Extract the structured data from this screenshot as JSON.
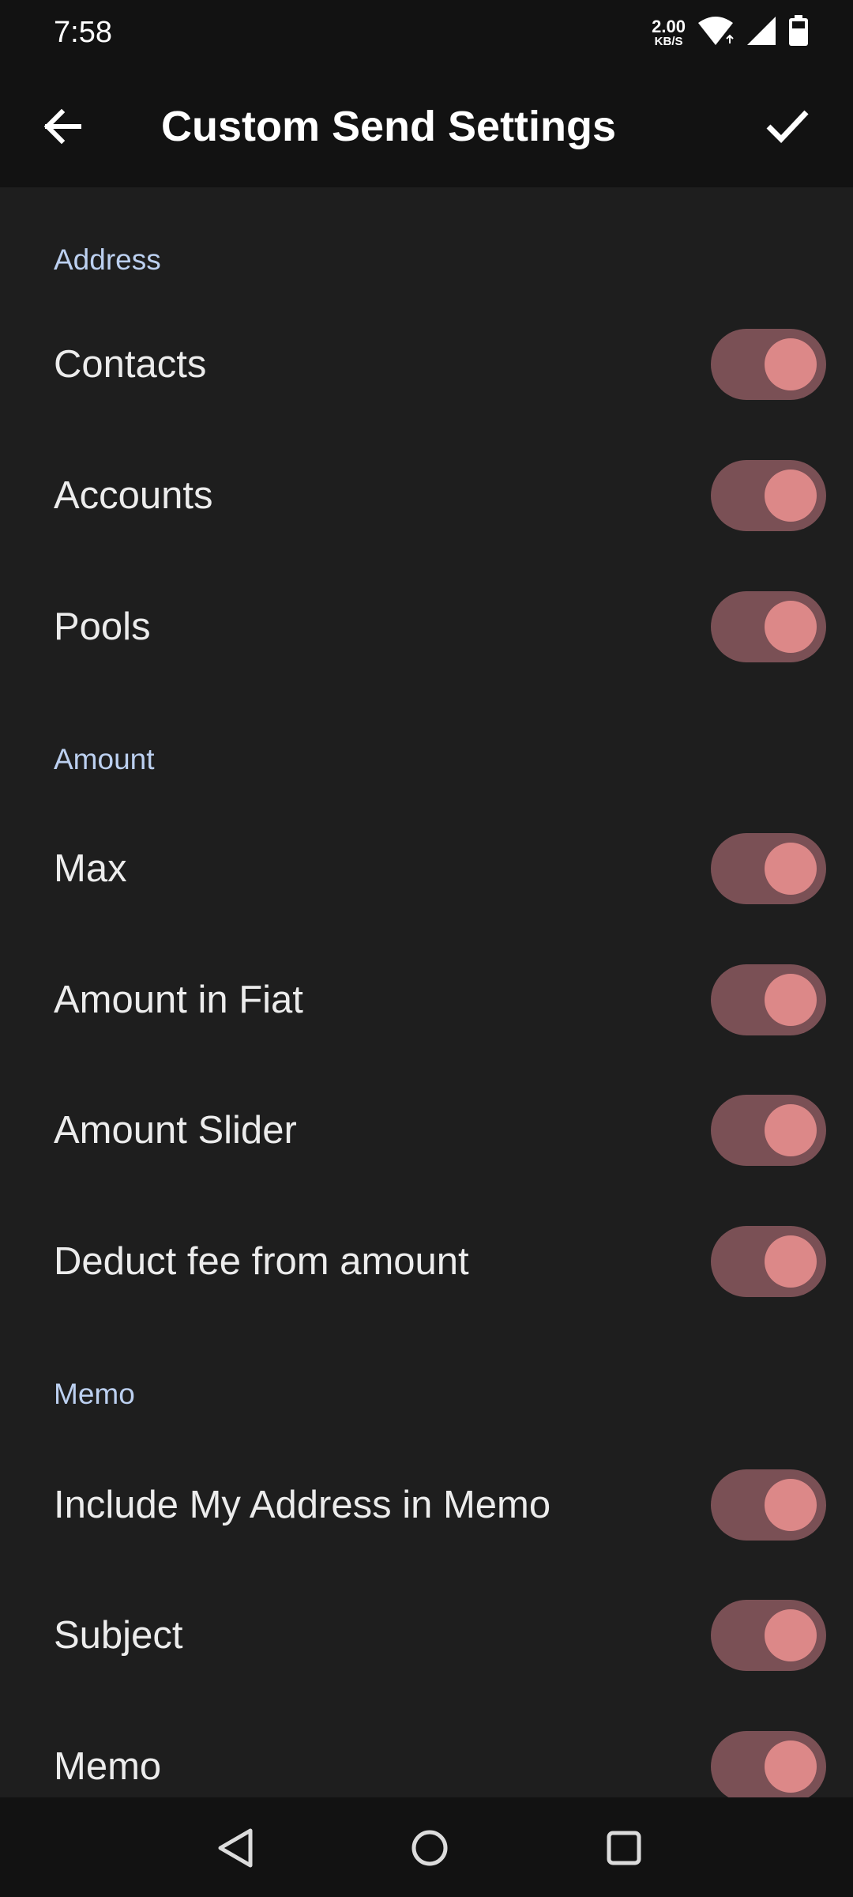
{
  "status_bar": {
    "time": "7:58",
    "net_speed_value": "2.00",
    "net_speed_unit": "KB/S",
    "icons": [
      "wifi-icon",
      "signal-icon",
      "battery-icon"
    ]
  },
  "app_bar": {
    "title": "Custom Send Settings",
    "back_icon": "arrow-back-icon",
    "confirm_icon": "check-icon"
  },
  "sections": {
    "address": {
      "header": "Address",
      "items": [
        {
          "label": "Contacts",
          "enabled": true
        },
        {
          "label": "Accounts",
          "enabled": true
        },
        {
          "label": "Pools",
          "enabled": true
        }
      ]
    },
    "amount": {
      "header": "Amount",
      "items": [
        {
          "label": "Max",
          "enabled": true
        },
        {
          "label": "Amount in Fiat",
          "enabled": true
        },
        {
          "label": "Amount Slider",
          "enabled": true
        },
        {
          "label": "Deduct fee from amount",
          "enabled": true
        }
      ]
    },
    "memo": {
      "header": "Memo",
      "items": [
        {
          "label": "Include My Address in Memo",
          "enabled": true
        },
        {
          "label": "Subject",
          "enabled": true
        },
        {
          "label": "Memo",
          "enabled": true
        }
      ]
    }
  },
  "colors": {
    "toggle_track_on": "#7a5055",
    "toggle_thumb_on": "#dc8888",
    "section_header": "#bcd0f0",
    "background": "#1e1e1e",
    "bars": "#121212"
  },
  "nav_bar": {
    "icons": [
      "back-triangle-icon",
      "home-circle-icon",
      "recents-square-icon"
    ]
  }
}
